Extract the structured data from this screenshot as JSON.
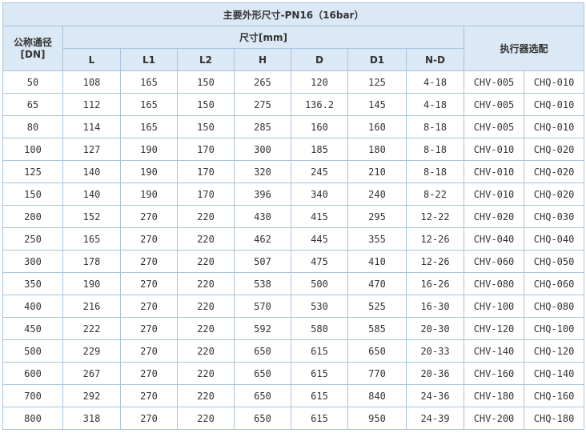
{
  "title": "主要外形尺寸-PN16（16bar）",
  "headers": {
    "dn": "公称通径[DN]",
    "dims_group": "尺寸[mm]",
    "actuator": "执行器选配",
    "columns": [
      "L",
      "L1",
      "L2",
      "H",
      "D",
      "D1",
      "N-D"
    ]
  },
  "rows": [
    [
      "50",
      "108",
      "165",
      "150",
      "265",
      "120",
      "125",
      "4-18",
      "CHV-005",
      "CHQ-010"
    ],
    [
      "65",
      "112",
      "165",
      "150",
      "275",
      "136.2",
      "145",
      "4-18",
      "CHV-005",
      "CHQ-010"
    ],
    [
      "80",
      "114",
      "165",
      "150",
      "285",
      "160",
      "160",
      "8-18",
      "CHV-005",
      "CHQ-010"
    ],
    [
      "100",
      "127",
      "190",
      "170",
      "300",
      "185",
      "180",
      "8-18",
      "CHV-010",
      "CHQ-020"
    ],
    [
      "125",
      "140",
      "190",
      "170",
      "320",
      "245",
      "210",
      "8-18",
      "CHV-010",
      "CHQ-020"
    ],
    [
      "150",
      "140",
      "190",
      "170",
      "396",
      "340",
      "240",
      "8-22",
      "CHV-010",
      "CHQ-020"
    ],
    [
      "200",
      "152",
      "270",
      "220",
      "430",
      "415",
      "295",
      "12-22",
      "CHV-020",
      "CHQ-030"
    ],
    [
      "250",
      "165",
      "270",
      "220",
      "462",
      "445",
      "355",
      "12-26",
      "CHV-040",
      "CHQ-040"
    ],
    [
      "300",
      "178",
      "270",
      "220",
      "507",
      "475",
      "410",
      "12-26",
      "CHV-060",
      "CHQ-050"
    ],
    [
      "350",
      "190",
      "270",
      "220",
      "538",
      "500",
      "470",
      "16-26",
      "CHV-080",
      "CHQ-060"
    ],
    [
      "400",
      "216",
      "270",
      "220",
      "570",
      "530",
      "525",
      "16-30",
      "CHV-100",
      "CHQ-080"
    ],
    [
      "450",
      "222",
      "270",
      "220",
      "592",
      "580",
      "585",
      "20-30",
      "CHV-120",
      "CHQ-100"
    ],
    [
      "500",
      "229",
      "270",
      "220",
      "650",
      "615",
      "650",
      "20-33",
      "CHV-140",
      "CHQ-120"
    ],
    [
      "600",
      "267",
      "270",
      "220",
      "650",
      "615",
      "770",
      "20-36",
      "CHV-160",
      "CHQ-140"
    ],
    [
      "700",
      "292",
      "270",
      "220",
      "650",
      "615",
      "840",
      "24-36",
      "CHV-180",
      "CHQ-160"
    ],
    [
      "800",
      "318",
      "270",
      "220",
      "650",
      "615",
      "950",
      "24-39",
      "CHV-200",
      "CHQ-180"
    ]
  ]
}
